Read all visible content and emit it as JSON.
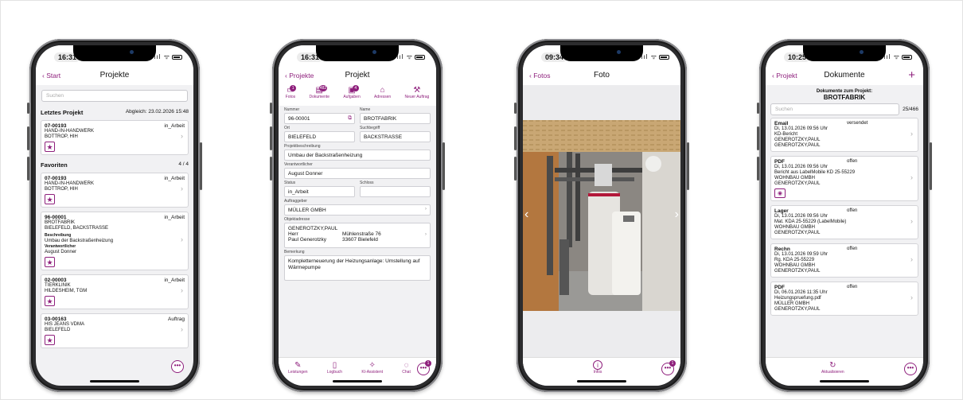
{
  "phones": {
    "p1": {
      "time": "16:31",
      "back": "Start",
      "title": "Projekte",
      "search_placeholder": "Suchen",
      "last_section": "Letztes Projekt",
      "last_sync": "Abgleich: 23.02.2026 15:48",
      "last_card": {
        "nr": "07-00193",
        "status": "in_Arbeit",
        "l1": "HAND-IN-HANDWERK",
        "l2": "BOTTROP, HIH"
      },
      "fav_section": "Favoriten",
      "fav_count": "4 / 4",
      "favs": [
        {
          "nr": "07-00193",
          "status": "in_Arbeit",
          "l1": "HAND-IN-HANDWERK",
          "l2": "BOTTROP, HIH"
        },
        {
          "nr": "96-00001",
          "status": "in_Arbeit",
          "l1": "BROTFABRIK",
          "l2": "BIELEFELD, BACKSTRASSE",
          "desc_label": "Beschreibung",
          "desc": "Umbau der Backstraßenheizung",
          "resp_label": "Verantwortlicher",
          "resp": "August Donner"
        },
        {
          "nr": "02-00003",
          "status": "in_Arbeit",
          "l1": "TIERKLINIK",
          "l2": "HILDESHEIM, TGM"
        },
        {
          "nr": "03-00163",
          "status": "Auftrag",
          "l1": "HIS JEANS VDMA",
          "l2": "BIELEFELD"
        }
      ],
      "star": "★",
      "more": "•••"
    },
    "p2": {
      "time": "16:31",
      "back": "Projekte",
      "title": "Projekt",
      "tabs": [
        {
          "label": "Fotos",
          "badge": "1",
          "icon": "photo-icon"
        },
        {
          "label": "Dokumente",
          "badge": "482",
          "icon": "document-icon"
        },
        {
          "label": "Aufgaben",
          "badge": "4",
          "icon": "task-icon"
        },
        {
          "label": "Adressen",
          "icon": "house-icon"
        },
        {
          "label": "Neuer Auftrag",
          "icon": "tools-icon"
        }
      ],
      "nummer_label": "Nummer",
      "nummer": "96-00001",
      "name_label": "Name",
      "name": "BROTFABRIK",
      "ort_label": "Ort",
      "ort": "BIELEFELD",
      "such_label": "Suchbegriff",
      "such": "BACKSTRASSE",
      "pb_label": "Projektbeschreibung",
      "pb": "Umbau der Backstraßenheizung",
      "vw_label": "Verantwortlicher",
      "vw": "August Donner",
      "status_label": "Status",
      "status": "in_Arbeit",
      "schloss_label": "Schloss",
      "schloss": "",
      "ag_label": "Auftraggeber",
      "ag": "MÜLLER GMBH",
      "oa_label": "Objektadresse",
      "oa_name": "GENEROTZKY,PAUL",
      "oa_anrede": "Herr",
      "oa_person": "Paul Generotzky",
      "oa_street": "Mühlenstraße 76",
      "oa_city": "33607 Bielefeld",
      "bem_label": "Bemerkung",
      "bem": "Kompletterneuerung der Heizungsanlage: Umstellung auf Wärmepumpe",
      "toolbar": [
        {
          "label": "Leistungen",
          "icon": "pencil-icon"
        },
        {
          "label": "Logbuch",
          "icon": "book-icon"
        },
        {
          "label": "KI-Assistent",
          "icon": "wand-icon"
        },
        {
          "label": "Chat",
          "icon": "chat-icon"
        }
      ],
      "more_badge": "1",
      "more": "•••"
    },
    "p3": {
      "time": "09:34",
      "back": "Fotos",
      "title": "Foto",
      "info_label": "Infos",
      "more_badge": "1",
      "more": "•••"
    },
    "p4": {
      "time": "10:25",
      "back": "Projekt",
      "title": "Dokumente",
      "plus": "+",
      "sub1": "Dokumente zum Projekt:",
      "sub2": "BROTFABRIK",
      "search_placeholder": "Suchen",
      "count": "25/466",
      "docs": [
        {
          "type": "Email",
          "status": "versendet",
          "lines": [
            "Di, 13.01.2026 09:56 Uhr",
            "KD-Bericht",
            "GENEROTZKY,PAUL",
            "GENEROTZKY,PAUL"
          ]
        },
        {
          "type": "PDF",
          "status": "offen",
          "lines": [
            "Di, 13.01.2026 09:56 Uhr",
            "Bericht aus LabelMobile KD 25-55229",
            "WOHNBAU GMBH",
            "GENEROTZKY,PAUL"
          ],
          "eye": true
        },
        {
          "type": "Lager",
          "status": "offen",
          "lines": [
            "Di, 13.01.2026 09:56 Uhr",
            "Mat. KDA 25-55229  (LabelMobile)",
            "WOHNBAU GMBH",
            "GENEROTZKY,PAUL"
          ]
        },
        {
          "type": "Rechn",
          "status": "offen",
          "lines": [
            "Di, 13.01.2026 09:59 Uhr",
            "Rg. KDA 25-55229",
            "WOHNBAU GMBH",
            "GENEROTZKY,PAUL"
          ]
        },
        {
          "type": "PDF",
          "status": "offen",
          "lines": [
            "Di, 06.01.2026 11:35 Uhr",
            "Heizungspruefung.pdf",
            "MÜLLER GMBH",
            "GENEROTZKY,PAUL"
          ]
        }
      ],
      "refresh_label": "Aktualisieren",
      "more": "•••"
    }
  },
  "colors": {
    "accent": "#8e1f7c"
  }
}
